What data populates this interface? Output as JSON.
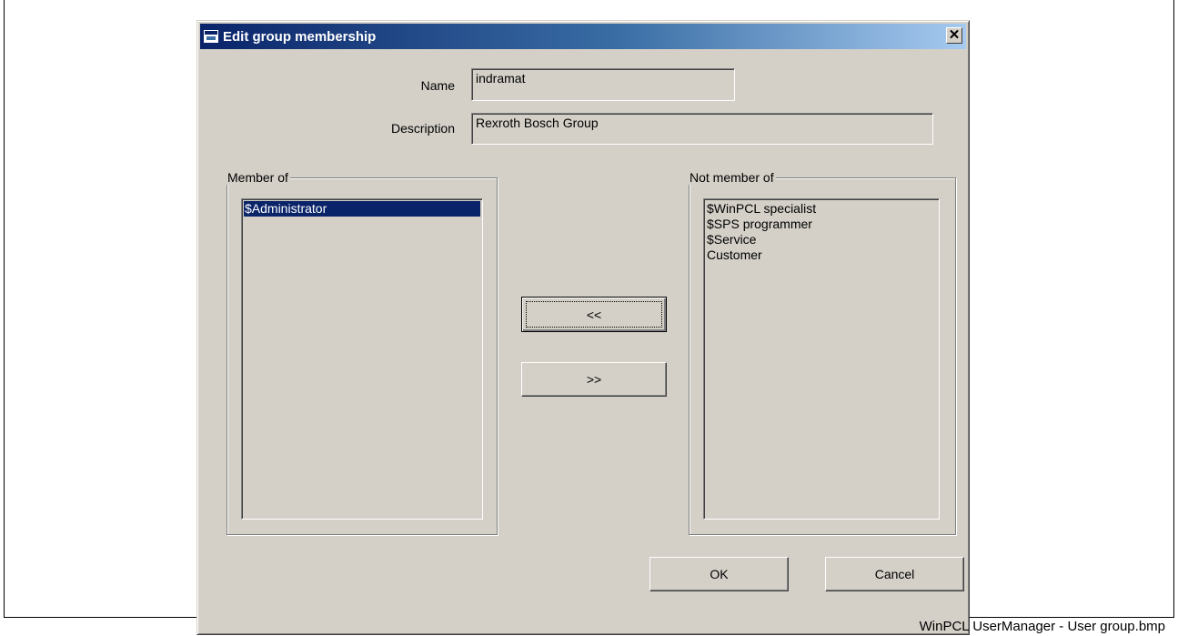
{
  "window": {
    "title": "Edit group membership",
    "close_glyph": "✕"
  },
  "form": {
    "name_label": "Name",
    "name_value": "indramat",
    "description_label": "Description",
    "description_value": "Rexroth Bosch Group"
  },
  "member_of": {
    "title": "Member of",
    "items": [
      "$Administrator"
    ],
    "selected_index": 0
  },
  "not_member_of": {
    "title": "Not member of",
    "items": [
      "$WinPCL specialist",
      "$SPS programmer",
      "$Service",
      "Customer"
    ]
  },
  "buttons": {
    "add_label": "<<",
    "remove_label": ">>",
    "ok_label": "OK",
    "cancel_label": "Cancel"
  },
  "caption": "WinPCL UserManager - User group.bmp",
  "colors": {
    "dialog_face": "#d4d0c8",
    "titlebar_start": "#0a246a",
    "titlebar_end": "#a6caf0",
    "selection": "#0a246a"
  }
}
